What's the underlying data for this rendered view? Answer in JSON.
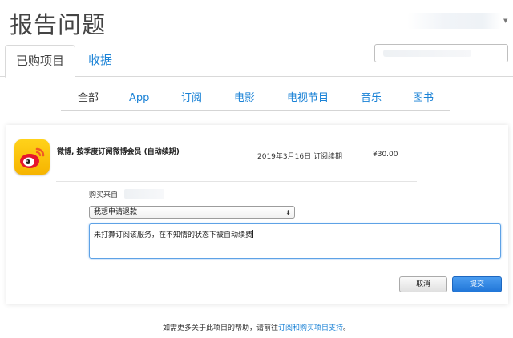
{
  "page": {
    "title": "报告问题"
  },
  "tabs": [
    {
      "label": "已购项目"
    },
    {
      "label": "收据"
    }
  ],
  "categories": [
    {
      "label": "全部"
    },
    {
      "label": "App"
    },
    {
      "label": "订阅"
    },
    {
      "label": "电影"
    },
    {
      "label": "电视节目"
    },
    {
      "label": "音乐"
    },
    {
      "label": "图书"
    }
  ],
  "item": {
    "name": "微博, 按季度订阅微博会员 (自动续期)",
    "date": "2019年3月16日 订阅续期",
    "price": "¥30.00",
    "icon": "weibo-logo-icon"
  },
  "form": {
    "bought_from_label": "购买来自:",
    "reason_selected": "我想申请退款",
    "message": "未打算订阅该服务，在不知情的状态下被自动续费"
  },
  "buttons": {
    "cancel": "取消",
    "submit": "提交"
  },
  "footer": {
    "prefix": "如需更多关于此项目的帮助，请前往",
    "link": "订阅和购买项目支持",
    "suffix": "。"
  },
  "colors": {
    "link": "#1a82d6",
    "submit": "#2176d8",
    "icon_bg": "#f6b400"
  }
}
